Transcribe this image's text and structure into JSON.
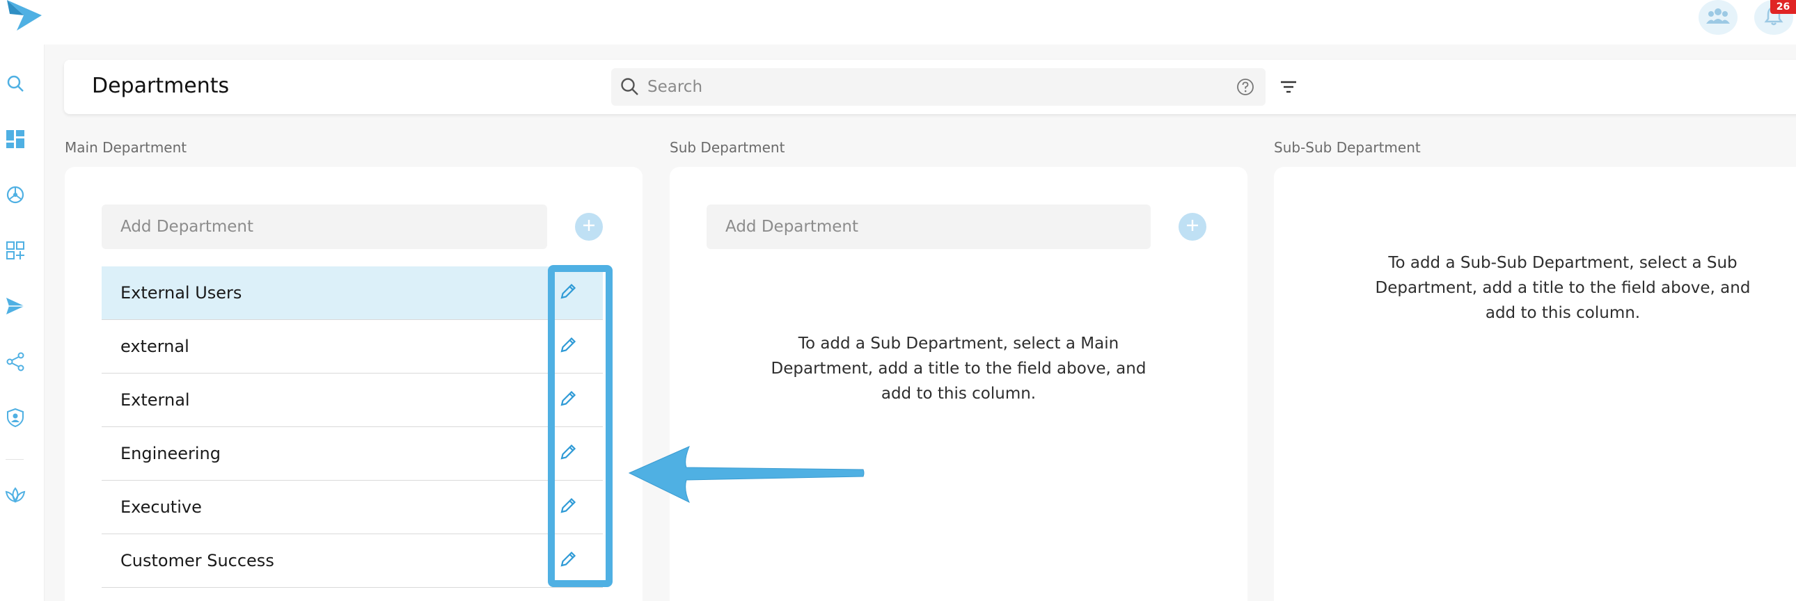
{
  "app": {
    "notification_count": "26"
  },
  "header": {
    "title": "Departments",
    "search_placeholder": "Search"
  },
  "columns": {
    "main": {
      "label": "Main Department",
      "add_placeholder": "Add Department",
      "items": [
        "External Users",
        "external",
        "External",
        "Engineering",
        "Executive",
        "Customer Success"
      ],
      "selected_index": 0
    },
    "sub": {
      "label": "Sub Department",
      "add_placeholder": "Add Department",
      "empty_message": "To add a Sub Department, select a Main Department, add a title to the field above, and add to this column."
    },
    "subsub": {
      "label": "Sub-Sub Department",
      "empty_message": "To add a Sub-Sub Department, select a Sub Department, add a title to the field above, and add to this column."
    }
  },
  "colors": {
    "accent": "#4fb0e3",
    "selected_row": "#dcf0f9",
    "badge": "#e02424"
  }
}
